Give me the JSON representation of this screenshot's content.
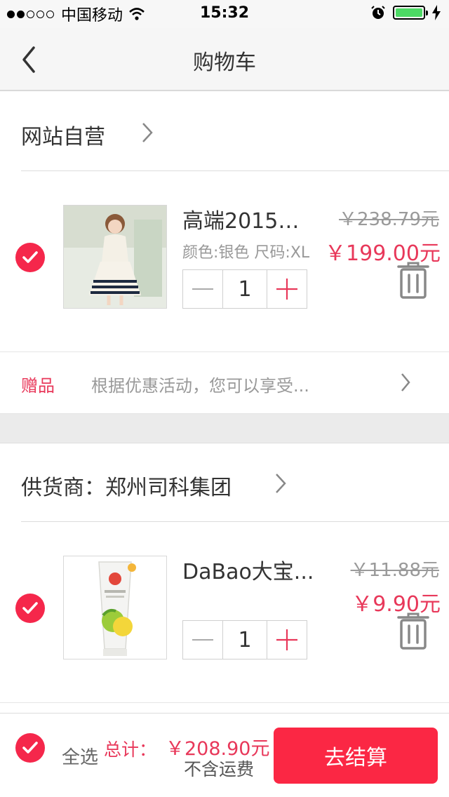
{
  "status_bar": {
    "carrier": "中国移动",
    "time": "15:32"
  },
  "nav": {
    "title": "购物车"
  },
  "stores": [
    {
      "name": "网站自营",
      "item": {
        "name": "高端2015夏...",
        "spec": "颜色:银色 尺码:XL",
        "quantity": "1",
        "original_price": "￥238.79元",
        "price": "￥199.00元",
        "checked": true
      },
      "gift": {
        "tag": "赠品",
        "description": "根据优惠活动，您可以享受..."
      }
    },
    {
      "name": "供货商：郑州司科集团",
      "item": {
        "name": "DaBao大宝...",
        "spec": "",
        "quantity": "1",
        "original_price": "￥11.88元",
        "price": "￥9.90元",
        "checked": true
      }
    }
  ],
  "footer": {
    "select_all_label": "全选",
    "total_label": "总计：",
    "total_value": "￥208.90元",
    "shipping_note": "不含运费",
    "checkout_label": "去结算"
  },
  "colors": {
    "accent": "#f5274b",
    "price": "#e8385a",
    "checkout": "#fb2744"
  }
}
